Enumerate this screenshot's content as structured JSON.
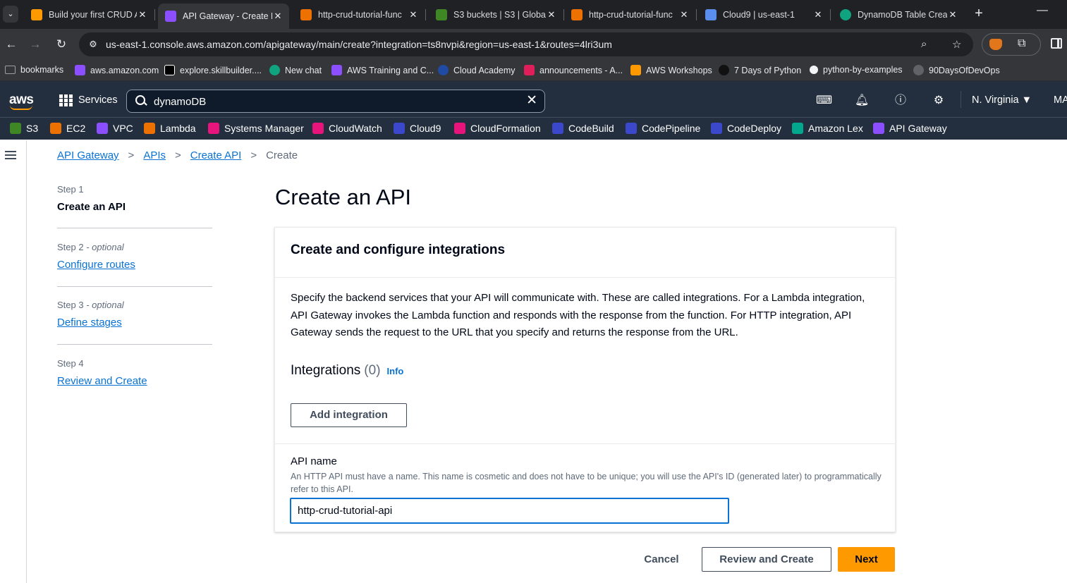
{
  "browser": {
    "tabs": [
      {
        "title": "Build your first CRUD A",
        "color": "#ff9900",
        "active": false
      },
      {
        "title": "API Gateway - Create H",
        "color": "#8c4fff",
        "active": true
      },
      {
        "title": "http-crud-tutorial-func",
        "color": "#ed7100",
        "active": false
      },
      {
        "title": "S3 buckets | S3 | Globa",
        "color": "#3f8624",
        "active": false
      },
      {
        "title": "http-crud-tutorial-func",
        "color": "#ed7100",
        "active": false
      },
      {
        "title": "Cloud9 | us-east-1",
        "color": "#5a8dee",
        "active": false
      },
      {
        "title": "DynamoDB Table Creat",
        "color": "#10a37f",
        "active": false
      }
    ],
    "url": "us-east-1.console.aws.amazon.com/apigateway/main/create?integration=ts8nvpi&region=us-east-1&routes=4lri3um",
    "bookmarks": [
      {
        "label": "bookmarks",
        "color": "#9aa0a6"
      },
      {
        "label": "aws.amazon.com",
        "color": "#8c4fff"
      },
      {
        "label": "explore.skillbuilder....",
        "color": "#232f3e"
      },
      {
        "label": "New chat",
        "color": "#10a37f"
      },
      {
        "label": "AWS Training and C...",
        "color": "#8c4fff"
      },
      {
        "label": "Cloud Academy",
        "color": "#1f4ba5"
      },
      {
        "label": "announcements - A...",
        "color": "#e01e5a"
      },
      {
        "label": "AWS Workshops",
        "color": "#ff9900"
      },
      {
        "label": "7 Days of Python",
        "color": "#111111"
      },
      {
        "label": "python-by-examples",
        "color": "#f1f3f4"
      },
      {
        "label": "90DaysOfDevOps",
        "color": "#5f6368"
      }
    ]
  },
  "console": {
    "logo": "aws",
    "services_label": "Services",
    "search_value": "dynamoDB",
    "region": "N. Virginia ▼",
    "account": "MA",
    "favorites": [
      {
        "label": "S3",
        "color": "#3f8624"
      },
      {
        "label": "EC2",
        "color": "#ed7100"
      },
      {
        "label": "VPC",
        "color": "#8c4fff"
      },
      {
        "label": "Lambda",
        "color": "#ed7100"
      },
      {
        "label": "Systems Manager",
        "color": "#e7157b"
      },
      {
        "label": "CloudWatch",
        "color": "#e7157b"
      },
      {
        "label": "Cloud9",
        "color": "#3b48cc"
      },
      {
        "label": "CloudFormation",
        "color": "#e7157b"
      },
      {
        "label": "CodeBuild",
        "color": "#3b48cc"
      },
      {
        "label": "CodePipeline",
        "color": "#3b48cc"
      },
      {
        "label": "CodeDeploy",
        "color": "#3b48cc"
      },
      {
        "label": "Amazon Lex",
        "color": "#01a88d"
      },
      {
        "label": "API Gateway",
        "color": "#8c4fff"
      }
    ]
  },
  "breadcrumb": {
    "items": [
      "API Gateway",
      "APIs",
      "Create API"
    ],
    "current": "Create"
  },
  "steps": [
    {
      "label": "Step 1",
      "optional": "",
      "title": "Create an API"
    },
    {
      "label": "Step 2",
      "optional": " - optional",
      "title": "Configure routes"
    },
    {
      "label": "Step 3",
      "optional": " - optional",
      "title": "Define stages"
    },
    {
      "label": "Step 4",
      "optional": "",
      "title": "Review and Create"
    }
  ],
  "main": {
    "title": "Create an API",
    "panel_title": "Create and configure integrations",
    "description": "Specify the backend services that your API will communicate with. These are called integrations. For a Lambda integration, API Gateway invokes the Lambda function and responds with the response from the function. For HTTP integration, API Gateway sends the request to the URL that you specify and returns the response from the URL.",
    "integrations_label": "Integrations",
    "integrations_count": "(0)",
    "info_link": "Info",
    "add_integration": "Add integration",
    "api_name_label": "API name",
    "api_name_desc": "An HTTP API must have a name. This name is cosmetic and does not have to be unique; you will use the API's ID (generated later) to programmatically refer to this API.",
    "api_name_value": "http-crud-tutorial-api"
  },
  "footer": {
    "cancel": "Cancel",
    "review": "Review and Create",
    "next": "Next"
  }
}
